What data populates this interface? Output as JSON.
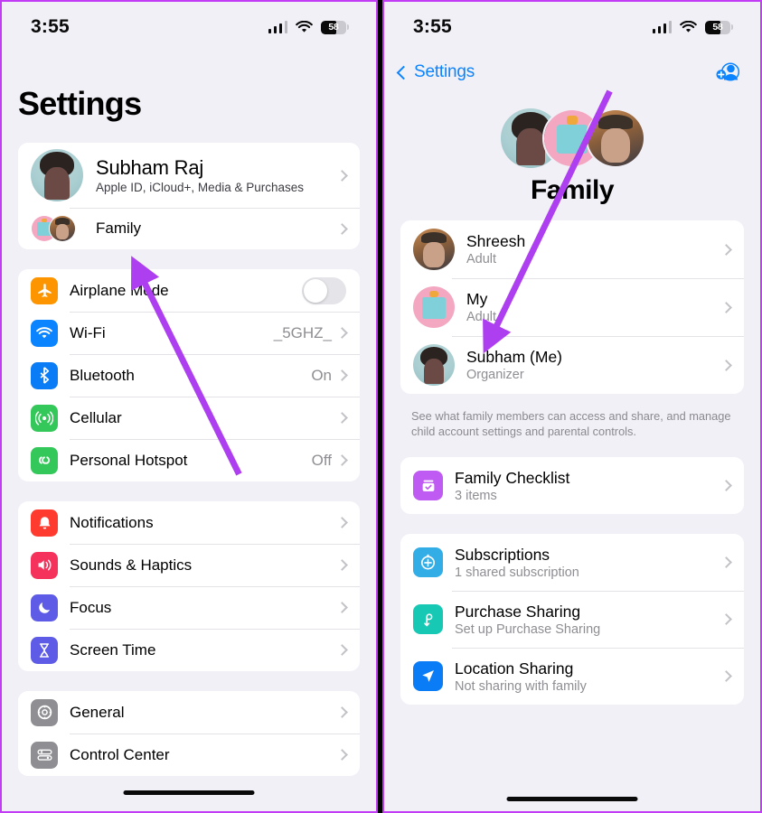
{
  "left": {
    "status": {
      "time": "3:55",
      "battery_percent": "58",
      "signal_icon": "cellular-bars-icon",
      "wifi_icon": "wifi-icon"
    },
    "title": "Settings",
    "account": {
      "name": "Subham Raj",
      "subtitle": "Apple ID, iCloud+, Media & Purchases",
      "family_label": "Family"
    },
    "connectivity": [
      {
        "label": "Airplane Mode",
        "value": "",
        "icon": "airplane-icon",
        "control": "toggle-off"
      },
      {
        "label": "Wi-Fi",
        "value": "_5GHZ_",
        "icon": "wifi-icon",
        "control": "chevron"
      },
      {
        "label": "Bluetooth",
        "value": "On",
        "icon": "bluetooth-icon",
        "control": "chevron"
      },
      {
        "label": "Cellular",
        "value": "",
        "icon": "cellular-icon",
        "control": "chevron"
      },
      {
        "label": "Personal Hotspot",
        "value": "Off",
        "icon": "hotspot-icon",
        "control": "chevron"
      }
    ],
    "alerts": [
      {
        "label": "Notifications",
        "icon": "bell-icon"
      },
      {
        "label": "Sounds & Haptics",
        "icon": "speaker-icon"
      },
      {
        "label": "Focus",
        "icon": "moon-icon"
      },
      {
        "label": "Screen Time",
        "icon": "hourglass-icon"
      }
    ],
    "system": [
      {
        "label": "General",
        "icon": "gear-icon"
      },
      {
        "label": "Control Center",
        "icon": "control-center-icon"
      }
    ]
  },
  "right": {
    "status": {
      "time": "3:55",
      "battery_percent": "58",
      "signal_icon": "cellular-bars-icon",
      "wifi_icon": "wifi-icon"
    },
    "nav": {
      "back_label": "Settings",
      "add_member_icon": "add-person-icon"
    },
    "hero": {
      "title": "Family"
    },
    "members": [
      {
        "name": "Shreesh",
        "role": "Adult",
        "avatar": "avatar-shreesh"
      },
      {
        "name": "My",
        "role": "Adult",
        "avatar": "avatar-robot"
      },
      {
        "name": "Subham (Me)",
        "role": "Organizer",
        "avatar": "avatar-subham"
      }
    ],
    "footnote": "See what family members can access and share, and manage child account settings and parental controls.",
    "checklist": [
      {
        "title": "Family Checklist",
        "subtitle": "3 items",
        "icon": "checklist-icon"
      }
    ],
    "sharing": [
      {
        "title": "Subscriptions",
        "subtitle": "1 shared subscription",
        "icon": "subscriptions-icon"
      },
      {
        "title": "Purchase Sharing",
        "subtitle": "Set up Purchase Sharing",
        "icon": "purchase-sharing-icon"
      },
      {
        "title": "Location Sharing",
        "subtitle": "Not sharing with family",
        "icon": "location-icon"
      }
    ]
  },
  "annotations": {
    "arrow_color": "#ad3ff0",
    "left_arrow_target": "Family row",
    "right_arrow_target": "My member row"
  }
}
